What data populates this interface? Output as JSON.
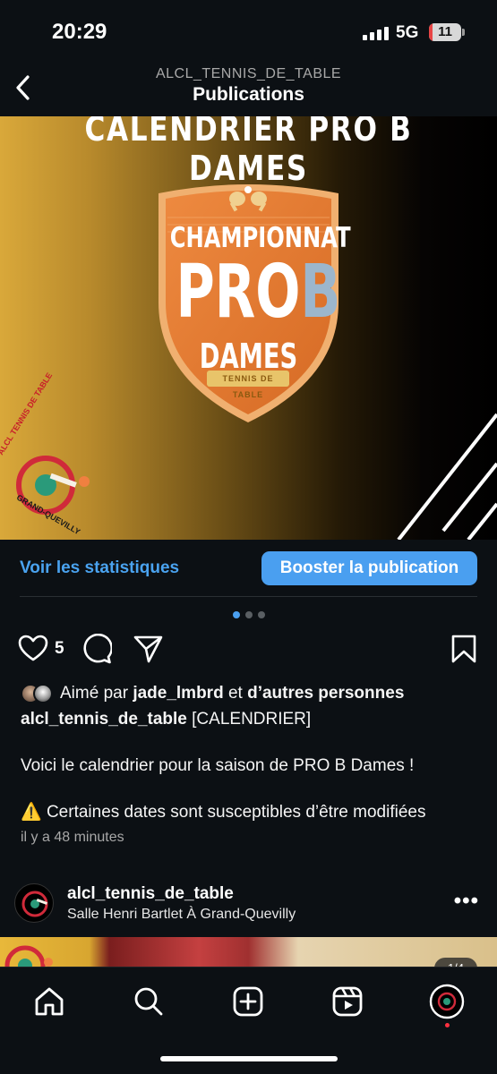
{
  "status_bar": {
    "time": "20:29",
    "network": "5G",
    "battery": "11",
    "battery_level": 0.11
  },
  "header": {
    "username": "ALCL_TENNIS_DE_TABLE",
    "title": "Publications"
  },
  "post_image": {
    "title": "CALENDRIER PRO B DAMES",
    "championnat": "CHAMPIONNAT",
    "pro": "PRO",
    "b": "B",
    "dames": "DAMES",
    "tennis_de_table": "TENNIS DE TABLE",
    "club_logo_text_top": "ALCL TENNIS DE TABLE",
    "club_logo_text_bottom": "GRAND-QUEVILLY"
  },
  "insights": {
    "stats_label": "Voir les statistiques",
    "boost_label": "Booster la publication"
  },
  "carousel": {
    "total": 3,
    "active": 0
  },
  "post_actions": {
    "like_count": "5"
  },
  "liked_by": {
    "prefix": "Aimé par",
    "user": "jade_lmbrd",
    "middle": "et",
    "others": "d’autres personnes"
  },
  "caption": {
    "username": "alcl_tennis_de_table",
    "tag": "[CALENDRIER]",
    "line2": "Voici le calendrier pour la saison de PRO B Dames !",
    "warning_emoji": "⚠️",
    "line3": "Certaines dates sont susceptibles d’être modifiées"
  },
  "time_ago": "il y a 48 minutes",
  "next_post": {
    "username": "alcl_tennis_de_table",
    "location": "Salle Henri Bartlet À Grand-Quevilly",
    "more": "•••",
    "page_indicator": "1/4"
  },
  "colors": {
    "accent": "#4a9ff0",
    "background": "#0c1014",
    "shield_orange": "#e07a34"
  }
}
